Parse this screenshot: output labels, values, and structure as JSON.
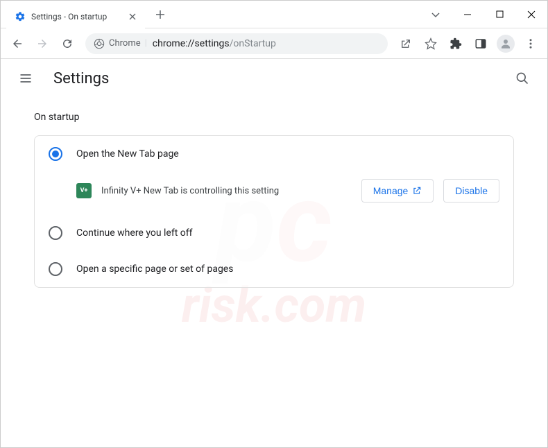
{
  "window": {
    "tab_title": "Settings - On startup"
  },
  "toolbar": {
    "secure_label": "Chrome",
    "url_host": "chrome://settings",
    "url_path": "/onStartup"
  },
  "settings": {
    "title": "Settings",
    "section_title": "On startup",
    "options": [
      {
        "label": "Open the New Tab page",
        "selected": true
      },
      {
        "label": "Continue where you left off",
        "selected": false
      },
      {
        "label": "Open a specific page or set of pages",
        "selected": false
      }
    ],
    "extension_badge": "V+",
    "controlling_text": "Infinity V+ New Tab is controlling this setting",
    "manage_label": "Manage",
    "disable_label": "Disable"
  }
}
